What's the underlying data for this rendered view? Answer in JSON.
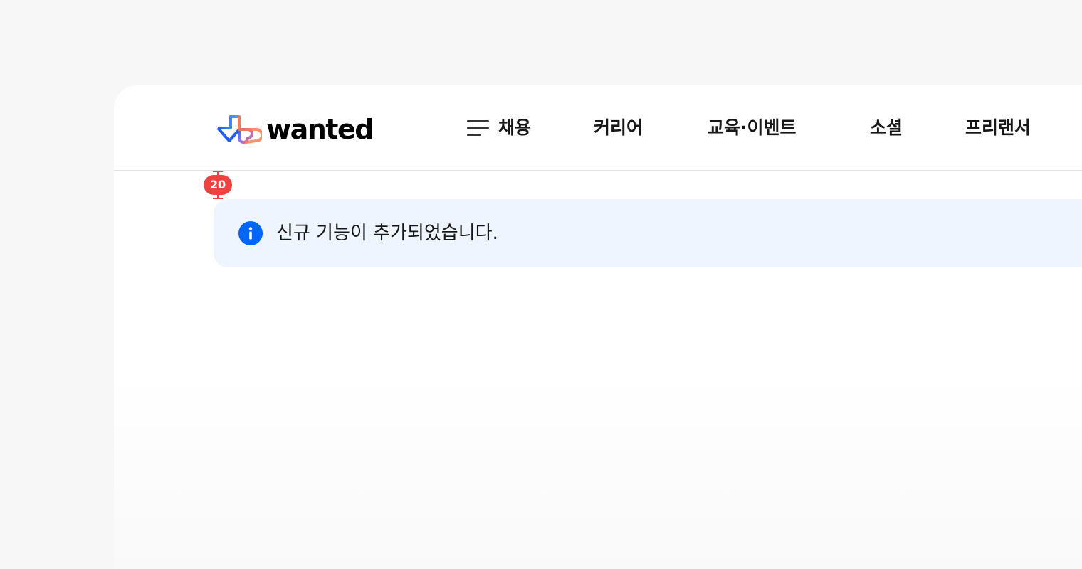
{
  "header": {
    "logo_text": "wanted",
    "nav": [
      {
        "label": "채용"
      },
      {
        "label": "커리어"
      },
      {
        "label": "교육·이벤트"
      },
      {
        "label": "소셜"
      },
      {
        "label": "프리랜서"
      }
    ]
  },
  "spacing_guide": {
    "label": "20"
  },
  "banner": {
    "message": "신규 기능이 추가되었습니다.",
    "icon": "info-icon"
  },
  "colors": {
    "page_background": "#f7f7f7",
    "card_background": "#ffffff",
    "banner_background": "#eff5ff",
    "info_icon": "#0066ff",
    "guide_red": "#f04040"
  }
}
